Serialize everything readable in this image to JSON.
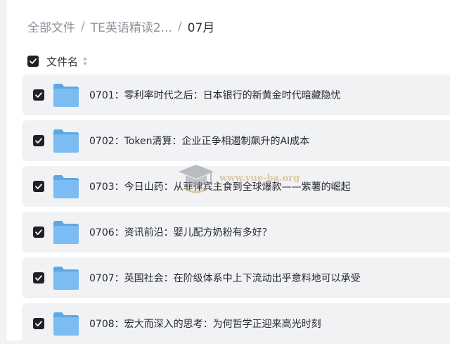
{
  "breadcrumb": {
    "root": "全部文件",
    "separator": "/",
    "parent": "TE英语精读2...",
    "current": "07月"
  },
  "header": {
    "select_all_checked": true,
    "column_label": "文件名"
  },
  "files": [
    {
      "name": "0701：零利率时代之后：日本银行的新黄金时代暗藏隐忧",
      "checked": true,
      "type": "folder"
    },
    {
      "name": "0702：Token清算：企业正争相遏制飙升的AI成本",
      "checked": true,
      "type": "folder"
    },
    {
      "name": "0703：今日山药：从菲律宾主食到全球爆款——紫薯的崛起",
      "checked": true,
      "type": "folder"
    },
    {
      "name": "0706：资讯前沿：婴儿配方奶粉有多好？",
      "checked": true,
      "type": "folder"
    },
    {
      "name": "0707：英国社会：在阶级体系中上下流动出乎意料地可以承受",
      "checked": true,
      "type": "folder"
    },
    {
      "name": "0708：宏大而深入的思考：为何哲学正迎来高光时刻",
      "checked": true,
      "type": "folder"
    }
  ],
  "watermark": {
    "text": "www.yue-ba.org"
  },
  "colors": {
    "row_bg": "#f1f2f4",
    "checkbox": "#1f2126",
    "folder": "#6aaeea",
    "text": "#26292e",
    "breadcrumb_muted": "#8e939c"
  }
}
